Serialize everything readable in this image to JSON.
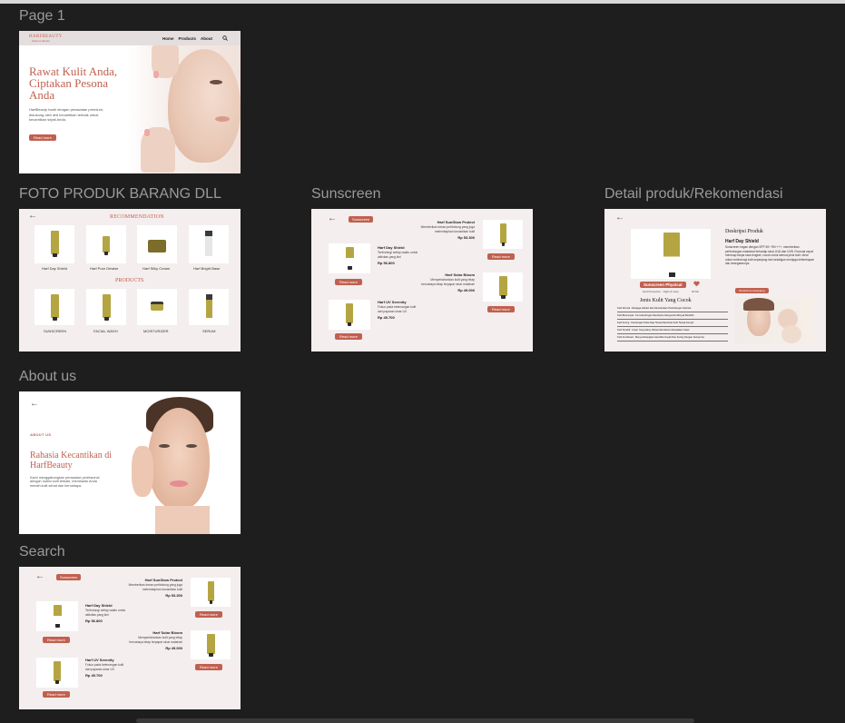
{
  "frames": {
    "page1": {
      "label": "Page 1"
    },
    "foto": {
      "label": "FOTO PRODUK BARANG DLL"
    },
    "sunscreen": {
      "label": "Sunscreen"
    },
    "detail": {
      "label": "Detail produk/Rekomendasi"
    },
    "about": {
      "label": "About us"
    },
    "search": {
      "label": "Search"
    }
  },
  "hero": {
    "logo": "HARFBEAUTY",
    "logo_tagline": "beauty & skincare",
    "nav": [
      "Home",
      "Products",
      "About"
    ],
    "headline": "Rawat Kulit Anda, Ciptakan Pesona Anda",
    "body": "HarfBeauty hadir dengan perawatan premium, didukung oleh ahli kecantikan terbaik untuk kecantikan sejati Anda.",
    "cta": "Read more"
  },
  "catalog": {
    "recommendation_title": "RECOMMENDATION",
    "products_title": "PRODUCTS",
    "recommendations": [
      "Harf Day Shield",
      "Harf Pure Dewise",
      "Harf Silky Cream",
      "Harf Bright Base"
    ],
    "products": [
      "SUNSCREEN",
      "FACIAL WASH",
      "MOISTURIZER",
      "SERUM"
    ]
  },
  "sunscreen_page": {
    "badge": "Sunscreen",
    "items": [
      {
        "name": "Harf SunGlow Protect",
        "desc": "Memberikan kesan perlindung yang juga melembapkan kecantikan kulit",
        "price": "Rp 53.300",
        "cta": "Read more"
      },
      {
        "name": "Harf Day Shield",
        "desc": "Terlindungi setiap waktu untuk aktivitas yang kini",
        "price": "Rp 56.800",
        "cta": "Read more"
      },
      {
        "name": "Harf Solar Bloom",
        "desc": "Mempertahankan kulit yang tetap bercahaya tetap terpapar sinar matahari",
        "price": "Rp 49.000",
        "cta": "Read more"
      },
      {
        "name": "Harf UV Serenity",
        "desc": "Fokus pada ketenangan kulit dari paparan sinar UV",
        "price": "Rp 45.700",
        "cta": "Read more"
      }
    ]
  },
  "detail_page": {
    "title": "Deskripsi Produk",
    "product_name": "Harf Day Shield",
    "description": "Sunscreen ringan dengan SPF 50+ PA++++, memberikan perlindungan maksimal terhadap sinar UVA dan UVB. Formula cepat meresap tanpa rasa lengket, cocok untuk semua jenis kulit. Ideal untuk melindungi kulit sepanjang hari sekaligus menjaga kelembapan dan kesegarannya.",
    "label": "Sunscreen Physical",
    "meta": "Harf Protection · Night & Care",
    "size": "30 ML",
    "buy_button": "Tambah ke keranjang",
    "skin_title": "Jenis Kulit Yang Cocok",
    "skin_types": [
      "Kulit Normal : Menjaga Hidrasi Dan Memberikan Perlindungan Optimal",
      "Kulit Berminyak : Formula Ringan Membantu Mengontrol Minyak Berlebih",
      "Kulit Kering : Kandungan Pelembap Terasa Membuat Kulit Terasa Kenyal",
      "Kulit Sensitif : Aman Yang Halus, Bebas Membantu Meredakan Iritasi",
      "Kulit Kombinasi : Menyeimbangkan Area Berminyak Dan Kering Dengan Sempurna"
    ]
  },
  "about_page": {
    "kicker": "ABOUT US",
    "headline": "Rahasia Kecantikan di HarfBeauty",
    "body": "Kami menggabungkan perawatan profesional dengan nutrisi kulit terbaik, membantu Anda meraih kulit sehat dan bercahaya."
  },
  "colors": {
    "accent": "#c1604f",
    "canvas": "#1e1e1e",
    "frame_bg": "#f4eeee",
    "product_olive": "#b5a542"
  },
  "icons": [
    "back-arrow-icon",
    "search-icon",
    "heart-icon"
  ]
}
